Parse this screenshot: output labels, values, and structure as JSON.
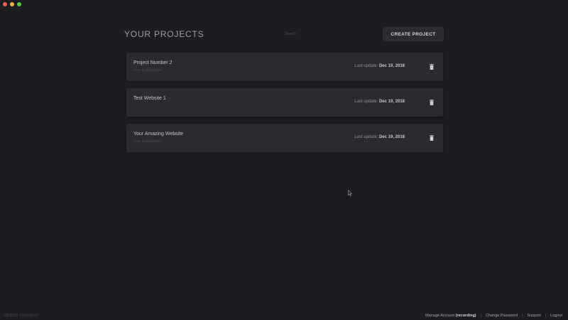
{
  "header": {
    "title": "YOUR PROJECTS",
    "search_placeholder": "Search",
    "create_button": "CREATE PROJECT"
  },
  "projects": [
    {
      "name": "Project Number 2",
      "subtitle": "Free Subscription",
      "last_update_label": "Last update:",
      "last_update_date": "Dec 19, 2018"
    },
    {
      "name": "Test Website 1",
      "subtitle": "",
      "last_update_label": "Last update:",
      "last_update_date": "Dec 19, 2018"
    },
    {
      "name": "Your Amazing Website",
      "subtitle": "Free Subscription",
      "last_update_label": "Last update:",
      "last_update_date": "Dec 19, 2018"
    }
  ],
  "footer": {
    "version": "REBOO V(version)",
    "manage_account": "Manage Account",
    "account_status": "(recording)",
    "change_password": "Change Password",
    "support": "Support",
    "logout": "Logout",
    "separator": "|"
  },
  "icons": {
    "trash": "trash-icon",
    "cursor": "cursor-icon"
  },
  "colors": {
    "background": "#1c1d21",
    "card": "#2a2b31",
    "button": "#2b2c31",
    "traffic_close": "#ee5a52",
    "traffic_minimize": "#f2b541",
    "traffic_maximize": "#5bc84a"
  }
}
